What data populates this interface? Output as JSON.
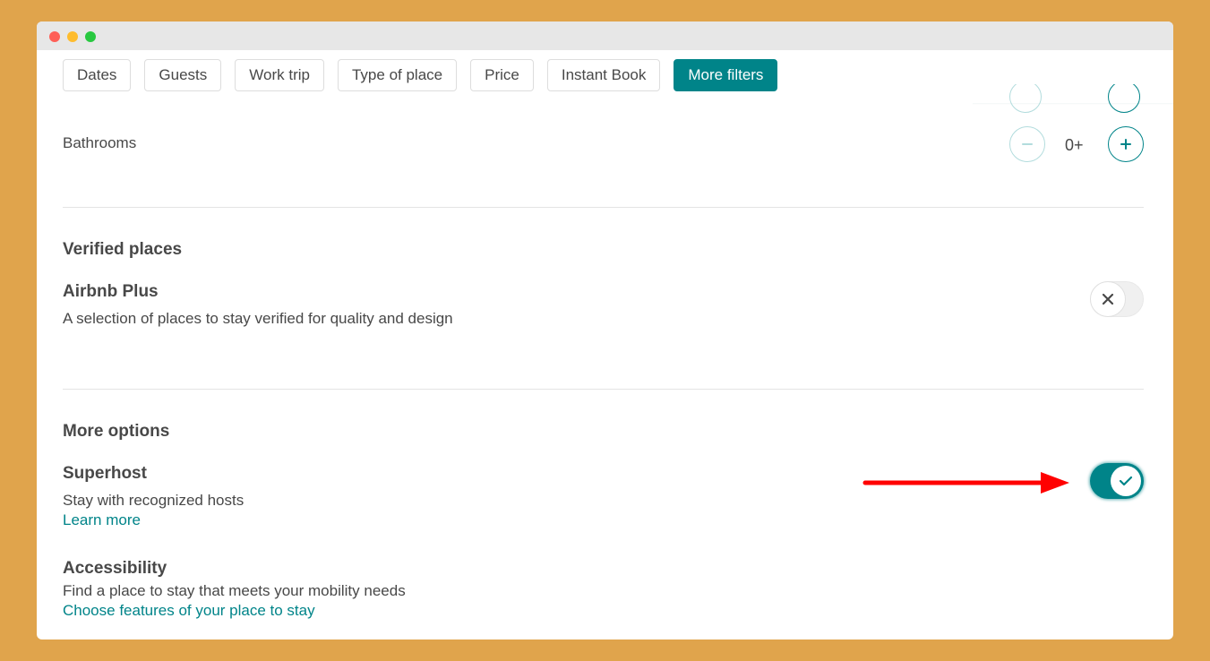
{
  "window": {
    "controls": [
      "close",
      "minimize",
      "maximize"
    ]
  },
  "filters": {
    "chips": [
      {
        "label": "Dates",
        "active": false
      },
      {
        "label": "Guests",
        "active": false
      },
      {
        "label": "Work trip",
        "active": false
      },
      {
        "label": "Type of place",
        "active": false
      },
      {
        "label": "Price",
        "active": false
      },
      {
        "label": "Instant Book",
        "active": false
      },
      {
        "label": "More filters",
        "active": true
      }
    ]
  },
  "rooms": {
    "bathrooms": {
      "label": "Bathrooms",
      "value": "0+",
      "minus_icon": "minus-icon",
      "plus_icon": "plus-icon"
    }
  },
  "verified_places": {
    "title": "Verified places",
    "airbnb_plus": {
      "title": "Airbnb Plus",
      "description": "A selection of places to stay verified for quality and design",
      "toggle_on": false,
      "toggle_icon": "close-icon"
    }
  },
  "more_options": {
    "title": "More options",
    "superhost": {
      "title": "Superhost",
      "description": "Stay with recognized hosts",
      "link": "Learn more",
      "toggle_on": true,
      "toggle_icon": "check-icon"
    },
    "accessibility": {
      "title": "Accessibility",
      "description": "Find a place to stay that meets your mobility needs",
      "link": "Choose features of your place to stay"
    }
  },
  "annotation": {
    "type": "arrow",
    "color": "#FF0000",
    "points_to": "superhost-toggle"
  },
  "colors": {
    "accent": "#008489",
    "background": "#E0A44C",
    "text": "#484848"
  }
}
